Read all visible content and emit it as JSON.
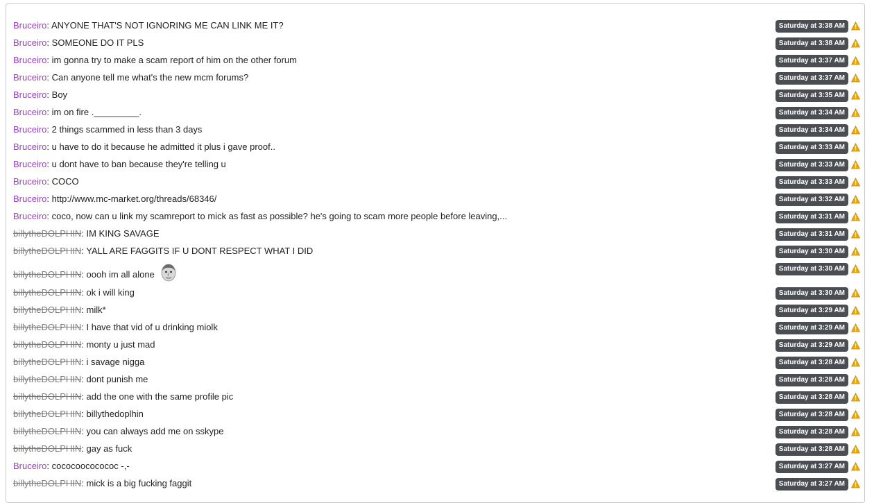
{
  "colors": {
    "active_author": "#9c3fd1",
    "banned_author": "#7a7a7a",
    "timestamp_bg": "#4a4d52",
    "warning_icon": "#f0a500"
  },
  "icons": {
    "report": "warning-icon",
    "emote": "face-emote-icon"
  },
  "messages": [
    {
      "author": "Bruceiro",
      "status": "active",
      "text": "ANYONE THAT'S NOT IGNORING ME CAN LINK ME IT?",
      "time": "Saturday at 3:38 AM"
    },
    {
      "author": "Bruceiro",
      "status": "active",
      "text": "SOMEONE DO IT PLS",
      "time": "Saturday at 3:38 AM"
    },
    {
      "author": "Bruceiro",
      "status": "active",
      "text": "im gonna try to make a scam report of him on the other forum",
      "time": "Saturday at 3:37 AM"
    },
    {
      "author": "Bruceiro",
      "status": "active",
      "text": "Can anyone tell me what's the new mcm forums?",
      "time": "Saturday at 3:37 AM"
    },
    {
      "author": "Bruceiro",
      "status": "active",
      "text": "Boy",
      "time": "Saturday at 3:35 AM"
    },
    {
      "author": "Bruceiro",
      "status": "active",
      "text": "im on fire ._________.",
      "time": "Saturday at 3:34 AM"
    },
    {
      "author": "Bruceiro",
      "status": "active",
      "text": "2 things scammed in less than 3 days",
      "time": "Saturday at 3:34 AM"
    },
    {
      "author": "Bruceiro",
      "status": "active",
      "text": "u have to do it because he admitted it plus i gave proof..",
      "time": "Saturday at 3:33 AM"
    },
    {
      "author": "Bruceiro",
      "status": "active",
      "text": "u dont have to ban because they're telling u",
      "time": "Saturday at 3:33 AM"
    },
    {
      "author": "Bruceiro",
      "status": "active",
      "text": "COCO",
      "time": "Saturday at 3:33 AM"
    },
    {
      "author": "Bruceiro",
      "status": "active",
      "text": "http://www.mc-market.org/threads/68346/",
      "time": "Saturday at 3:32 AM",
      "link": true
    },
    {
      "author": "Bruceiro",
      "status": "active",
      "text": "coco, now can u link my scamreport to mick as fast as possible? he's going to scam more people before leaving,...",
      "time": "Saturday at 3:31 AM"
    },
    {
      "author": "billytheDOLPHIN",
      "status": "banned",
      "text": "IM KING SAVAGE",
      "time": "Saturday at 3:31 AM"
    },
    {
      "author": "billytheDOLPHIN",
      "status": "banned",
      "text": "YALL ARE FAGGITS IF U DONT RESPECT WHAT I DID",
      "time": "Saturday at 3:30 AM"
    },
    {
      "author": "billytheDOLPHIN",
      "status": "banned",
      "text": "oooh im all alone",
      "time": "Saturday at 3:30 AM",
      "emote": true
    },
    {
      "author": "billytheDOLPHIN",
      "status": "banned",
      "text": "ok i will king",
      "time": "Saturday at 3:30 AM"
    },
    {
      "author": "billytheDOLPHIN",
      "status": "banned",
      "text": "milk*",
      "time": "Saturday at 3:29 AM"
    },
    {
      "author": "billytheDOLPHIN",
      "status": "banned",
      "text": "I have that vid of u drinking miolk",
      "time": "Saturday at 3:29 AM"
    },
    {
      "author": "billytheDOLPHIN",
      "status": "banned",
      "text": "monty u just mad",
      "time": "Saturday at 3:29 AM"
    },
    {
      "author": "billytheDOLPHIN",
      "status": "banned",
      "text": "i savage nigga",
      "time": "Saturday at 3:28 AM"
    },
    {
      "author": "billytheDOLPHIN",
      "status": "banned",
      "text": "dont punish me",
      "time": "Saturday at 3:28 AM"
    },
    {
      "author": "billytheDOLPHIN",
      "status": "banned",
      "text": "add the one with the same profile pic",
      "time": "Saturday at 3:28 AM"
    },
    {
      "author": "billytheDOLPHIN",
      "status": "banned",
      "text": "billythedoplhin",
      "time": "Saturday at 3:28 AM"
    },
    {
      "author": "billytheDOLPHIN",
      "status": "banned",
      "text": "you can always add me on sskype",
      "time": "Saturday at 3:28 AM"
    },
    {
      "author": "billytheDOLPHIN",
      "status": "banned",
      "text": "gay as fuck",
      "time": "Saturday at 3:28 AM"
    },
    {
      "author": "Bruceiro",
      "status": "active",
      "text": "cococoococococ -,-",
      "time": "Saturday at 3:27 AM"
    },
    {
      "author": "billytheDOLPHIN",
      "status": "banned",
      "text": "mick is a big fucking faggit",
      "time": "Saturday at 3:27 AM"
    }
  ]
}
